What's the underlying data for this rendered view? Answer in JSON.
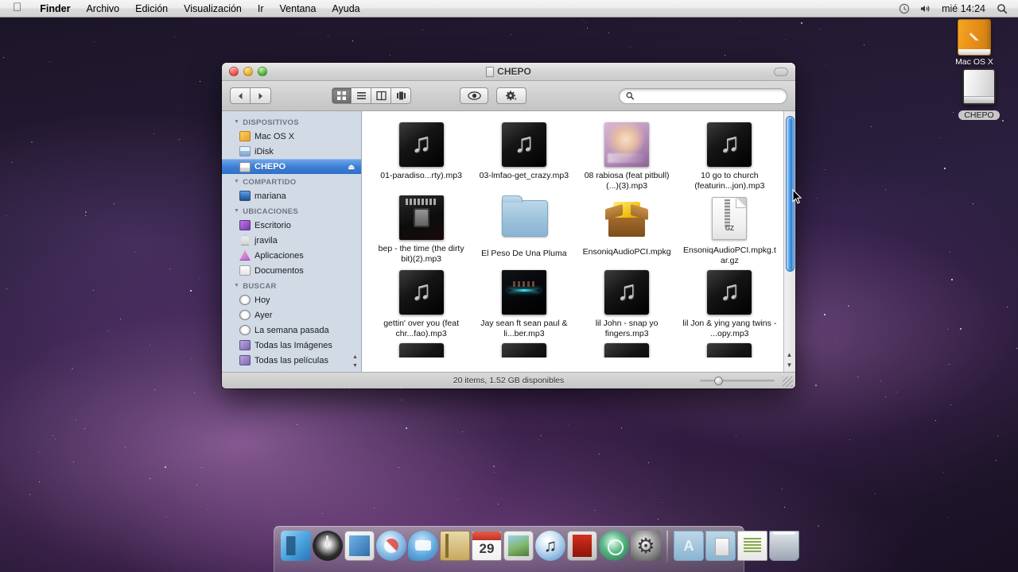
{
  "menubar": {
    "apple": "apple-logo",
    "items": [
      {
        "label": "Finder",
        "bold": true
      },
      {
        "label": "Archivo",
        "bold": false
      },
      {
        "label": "Edición",
        "bold": false
      },
      {
        "label": "Visualización",
        "bold": false
      },
      {
        "label": "Ir",
        "bold": false
      },
      {
        "label": "Ventana",
        "bold": false
      },
      {
        "label": "Ayuda",
        "bold": false
      }
    ],
    "status": {
      "time_machine_icon": "◴",
      "volume_icon": "◂)",
      "clock": "mié 14:24",
      "spotlight_icon": "⌕"
    }
  },
  "desktop": {
    "icons": [
      {
        "label": "Mac OS X",
        "type": "hard-drive",
        "selected": false
      },
      {
        "label": "CHEPO",
        "type": "removable-drive",
        "selected": true
      }
    ]
  },
  "finder": {
    "title": "CHEPO",
    "toolbar": {
      "back_icon": "◀",
      "forward_icon": "▶",
      "view_icon_label": "▒",
      "view_list_label": "☰",
      "view_column_label": "‖",
      "view_coverflow_label": "█‖",
      "quicklook_icon": "◉",
      "action_icon": "⚙",
      "action_chevron": "▾",
      "search_icon": "⌕",
      "search_value": "",
      "search_placeholder": ""
    },
    "sidebar": {
      "sections": [
        {
          "title": "DISPOSITIVOS",
          "items": [
            {
              "label": "Mac OS X",
              "icon": "ic-hd-orange",
              "selected": false,
              "eject": false
            },
            {
              "label": "iDisk",
              "icon": "ic-idisk",
              "selected": false,
              "eject": false
            },
            {
              "label": "CHEPO",
              "icon": "ic-drive",
              "selected": true,
              "eject": true
            }
          ]
        },
        {
          "title": "COMPARTIDO",
          "items": [
            {
              "label": "mariana",
              "icon": "ic-screen",
              "selected": false,
              "eject": false
            }
          ]
        },
        {
          "title": "UBICACIONES",
          "items": [
            {
              "label": "Escritorio",
              "icon": "ic-desktop",
              "selected": false,
              "eject": false
            },
            {
              "label": "jravila",
              "icon": "ic-home",
              "selected": false,
              "eject": false
            },
            {
              "label": "Aplicaciones",
              "icon": "ic-apps",
              "selected": false,
              "eject": false
            },
            {
              "label": "Documentos",
              "icon": "ic-docs",
              "selected": false,
              "eject": false
            }
          ]
        },
        {
          "title": "BUSCAR",
          "items": [
            {
              "label": "Hoy",
              "icon": "ic-clock",
              "selected": false,
              "eject": false
            },
            {
              "label": "Ayer",
              "icon": "ic-clock",
              "selected": false,
              "eject": false
            },
            {
              "label": "La semana pasada",
              "icon": "ic-clock",
              "selected": false,
              "eject": false
            },
            {
              "label": "Todas las Imágenes",
              "icon": "ic-smart",
              "selected": false,
              "eject": false
            },
            {
              "label": "Todas las películas",
              "icon": "ic-smart",
              "selected": false,
              "eject": false
            }
          ]
        }
      ],
      "eject_glyph": "⏏"
    },
    "files": [
      {
        "name": "01-paradiso...rty).mp3",
        "kind": "mp3"
      },
      {
        "name": "03-lmfao-get_crazy.mp3",
        "kind": "mp3"
      },
      {
        "name": "08 rabiosa (feat pitbull) (...)(3).mp3",
        "kind": "art-rabiosa"
      },
      {
        "name": "10 go to church (featurin...jon).mp3",
        "kind": "mp3"
      },
      {
        "name": "bep - the time (the dirty bit)(2).mp3",
        "kind": "art-bep"
      },
      {
        "name": "El Peso De Una Pluma",
        "kind": "folder"
      },
      {
        "name": "EnsoniqAudioPCI.mpkg",
        "kind": "pkg"
      },
      {
        "name": "EnsoniqAudioPCI.mpkg.tar.gz",
        "kind": "gz"
      },
      {
        "name": "gettin' over you (feat chr...fao).mp3",
        "kind": "mp3"
      },
      {
        "name": "Jay sean ft sean paul & li...ber.mp3",
        "kind": "art-jay"
      },
      {
        "name": "lil John - snap yo fingers.mp3",
        "kind": "mp3"
      },
      {
        "name": "lil Jon & ying yang twins - ...opy.mp3",
        "kind": "mp3"
      }
    ],
    "gz_badge": "GZ",
    "music_note_glyph": "♫",
    "status": "20 items, 1.52 GB disponibles",
    "scroll_up_glyph": "▲",
    "scroll_down_glyph": "▼"
  },
  "dock": {
    "items": [
      {
        "name": "finder",
        "cls": "d-finder"
      },
      {
        "name": "dashboard",
        "cls": "d-dash"
      },
      {
        "name": "mail",
        "cls": "d-mail"
      },
      {
        "name": "safari",
        "cls": "d-safari"
      },
      {
        "name": "ichat",
        "cls": "d-ichat"
      },
      {
        "name": "address-book",
        "cls": "d-ab"
      },
      {
        "name": "ical",
        "cls": "d-ical"
      },
      {
        "name": "iphoto",
        "cls": "d-iphoto"
      },
      {
        "name": "itunes",
        "cls": "d-itunes"
      },
      {
        "name": "dvd-player",
        "cls": "d-red"
      },
      {
        "name": "time-machine",
        "cls": "d-tm"
      },
      {
        "name": "system-preferences",
        "cls": "d-sysprefs"
      },
      {
        "name": "separator",
        "cls": "sep"
      },
      {
        "name": "applications-folder",
        "cls": "d-appsfolder"
      },
      {
        "name": "documents-folder",
        "cls": "d-docsfolder"
      },
      {
        "name": "document",
        "cls": "d-doc"
      },
      {
        "name": "trash",
        "cls": "d-trash"
      }
    ]
  }
}
